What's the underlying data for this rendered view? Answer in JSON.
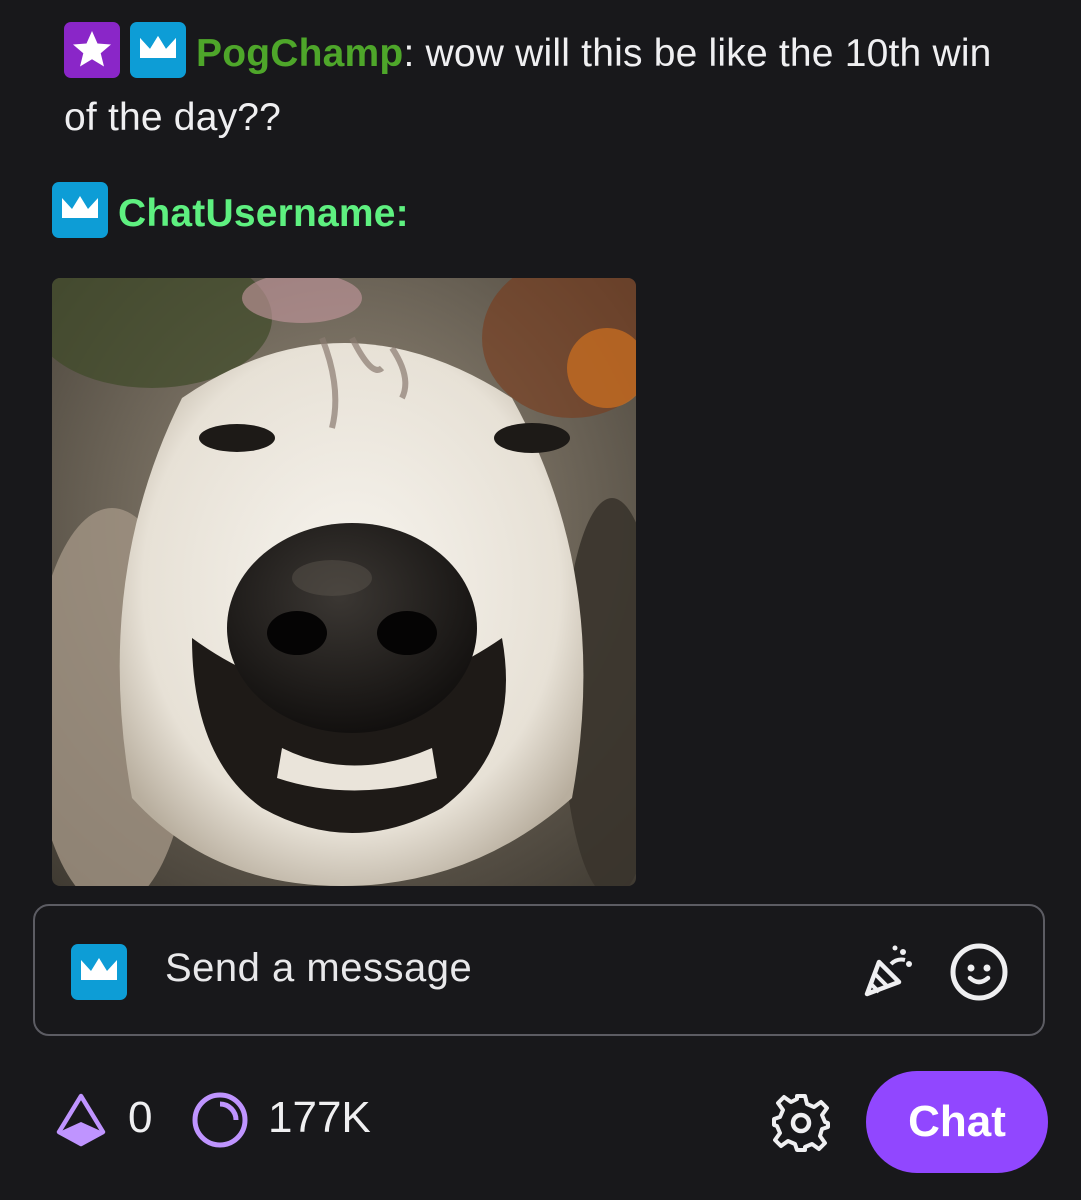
{
  "messages": [
    {
      "username": "PogChamp",
      "separator": ":",
      "text": " wow will this be like the 10th win of the day??",
      "badges": [
        "star-badge-icon",
        "crown-badge-icon"
      ],
      "username_color": "#4ea62a"
    },
    {
      "username": "ChatUsername",
      "separator": ":",
      "text": "",
      "badges": [
        "crown-badge-icon"
      ],
      "username_color": "#5ef080",
      "attachment": "smiling-dog-gif"
    }
  ],
  "input": {
    "placeholder": "Send a message",
    "icons": [
      "crown-badge-icon",
      "party-popper-icon",
      "emote-smile-icon"
    ]
  },
  "bottom_bar": {
    "bits_icon": "bits-icon",
    "bits_count": "0",
    "points_icon": "channel-points-icon",
    "points_count": "177K",
    "settings_icon": "gear-icon",
    "chat_button_label": "Chat"
  },
  "colors": {
    "background": "#18181b",
    "accent": "#9147ff",
    "crown_badge": "#0d9dd6",
    "star_badge": "#8a26c8"
  }
}
